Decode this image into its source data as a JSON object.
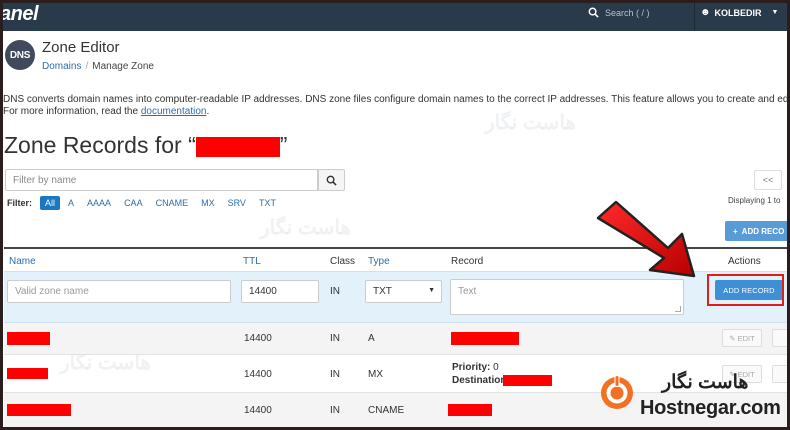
{
  "topbar": {
    "brand": "anel",
    "search_label": "Search ( / )",
    "user": "KOLBEDIR"
  },
  "app": {
    "icon_text": "DNS",
    "title": "Zone Editor"
  },
  "breadcrumb": {
    "root": "Domains",
    "separator": "/",
    "current": "Manage Zone"
  },
  "description": {
    "line1": "DNS converts domain names into computer-readable IP addresses. DNS zone files configure domain names to the correct IP addresses. This feature allows you to create and edit th",
    "line2_prefix": "For more information, read the ",
    "line2_link": "documentation",
    "line2_suffix": "."
  },
  "section": {
    "title_prefix": "Zone Records for “",
    "title_suffix": "”"
  },
  "filter": {
    "placeholder": "Filter by name",
    "label": "Filter:",
    "types": [
      "All",
      "A",
      "AAAA",
      "CAA",
      "CNAME",
      "MX",
      "SRV",
      "TXT"
    ],
    "active": "All"
  },
  "pager": {
    "first": "<<",
    "displaying": "Displaying 1 to"
  },
  "add_record_top": "ADD RECO",
  "table": {
    "headers": {
      "name": "Name",
      "ttl": "TTL",
      "class": "Class",
      "type": "Type",
      "record": "Record",
      "actions": "Actions"
    },
    "new_row": {
      "name_placeholder": "Valid zone name",
      "ttl_value": "14400",
      "class_value": "IN",
      "type_value": "TXT",
      "record_placeholder": "Text",
      "add_button": "ADD RECORD"
    },
    "rows": [
      {
        "ttl": "14400",
        "class": "IN",
        "type": "A",
        "edit": "EDIT"
      },
      {
        "ttl": "14400",
        "class": "IN",
        "type": "MX",
        "priority_label": "Priority:",
        "priority_value": "0",
        "destination_label": "Destination:",
        "edit": "EDIT"
      },
      {
        "ttl": "14400",
        "class": "IN",
        "type": "CNAME"
      }
    ]
  },
  "watermark": {
    "fa": "هاست نگار",
    "en": "Hostnegar.com"
  },
  "colors": {
    "topbar": "#293a4a",
    "accent": "#1c77c3",
    "redaction": "#ff0000",
    "highlight_row": "#e3f1fb"
  }
}
